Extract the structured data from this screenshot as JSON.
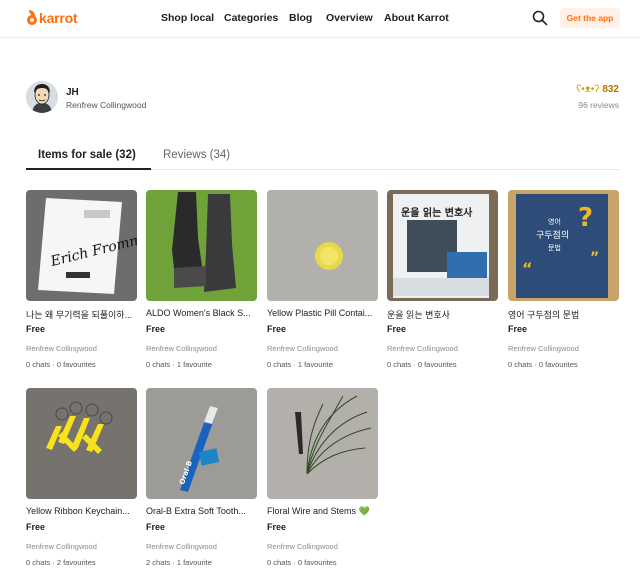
{
  "header": {
    "logo_text": "karrot",
    "nav": [
      "Shop local",
      "Categories",
      "Blog",
      "Overview",
      "About Karrot"
    ],
    "get_app": "Get the app",
    "brand_color": "#ff6f0f"
  },
  "profile": {
    "name": "JH",
    "location": "Renfrew Collingwood",
    "score": "832",
    "score_icon": "bear-face-icon",
    "reviews_count": "96 reviews"
  },
  "tabs": {
    "items_for_sale": "Items for sale (32)",
    "reviews": "Reviews (34)"
  },
  "items": [
    {
      "title": "나는 왜 무기력을 되풀이하...",
      "price": "Free",
      "location": "Renfrew Collingwood",
      "meta": "0 chats · 0 favourites"
    },
    {
      "title": "ALDO Women's Black S...",
      "price": "Free",
      "location": "Renfrew Collingwood",
      "meta": "0 chats · 1 favourite"
    },
    {
      "title": "Yellow Plastic Pill Contai...",
      "price": "Free",
      "location": "Renfrew Collingwood",
      "meta": "0 chats · 1 favourite"
    },
    {
      "title": "운을 읽는 변호사",
      "price": "Free",
      "location": "Renfrew Collingwood",
      "meta": "0 chats · 0 favourites"
    },
    {
      "title": "영어 구두점의 문법",
      "price": "Free",
      "location": "Renfrew Collingwood",
      "meta": "0 chats · 0 favourites"
    },
    {
      "title": "Yellow Ribbon Keychain...",
      "price": "Free",
      "location": "Renfrew Collingwood",
      "meta": "0 chats · 2 favourites"
    },
    {
      "title": "Oral-B Extra Soft Tooth...",
      "price": "Free",
      "location": "Renfrew Collingwood",
      "meta": "2 chats · 1 favourite"
    },
    {
      "title": "Floral Wire and Stems 💚",
      "price": "Free",
      "location": "Renfrew Collingwood",
      "meta": "0 chats · 0 favourites"
    }
  ]
}
